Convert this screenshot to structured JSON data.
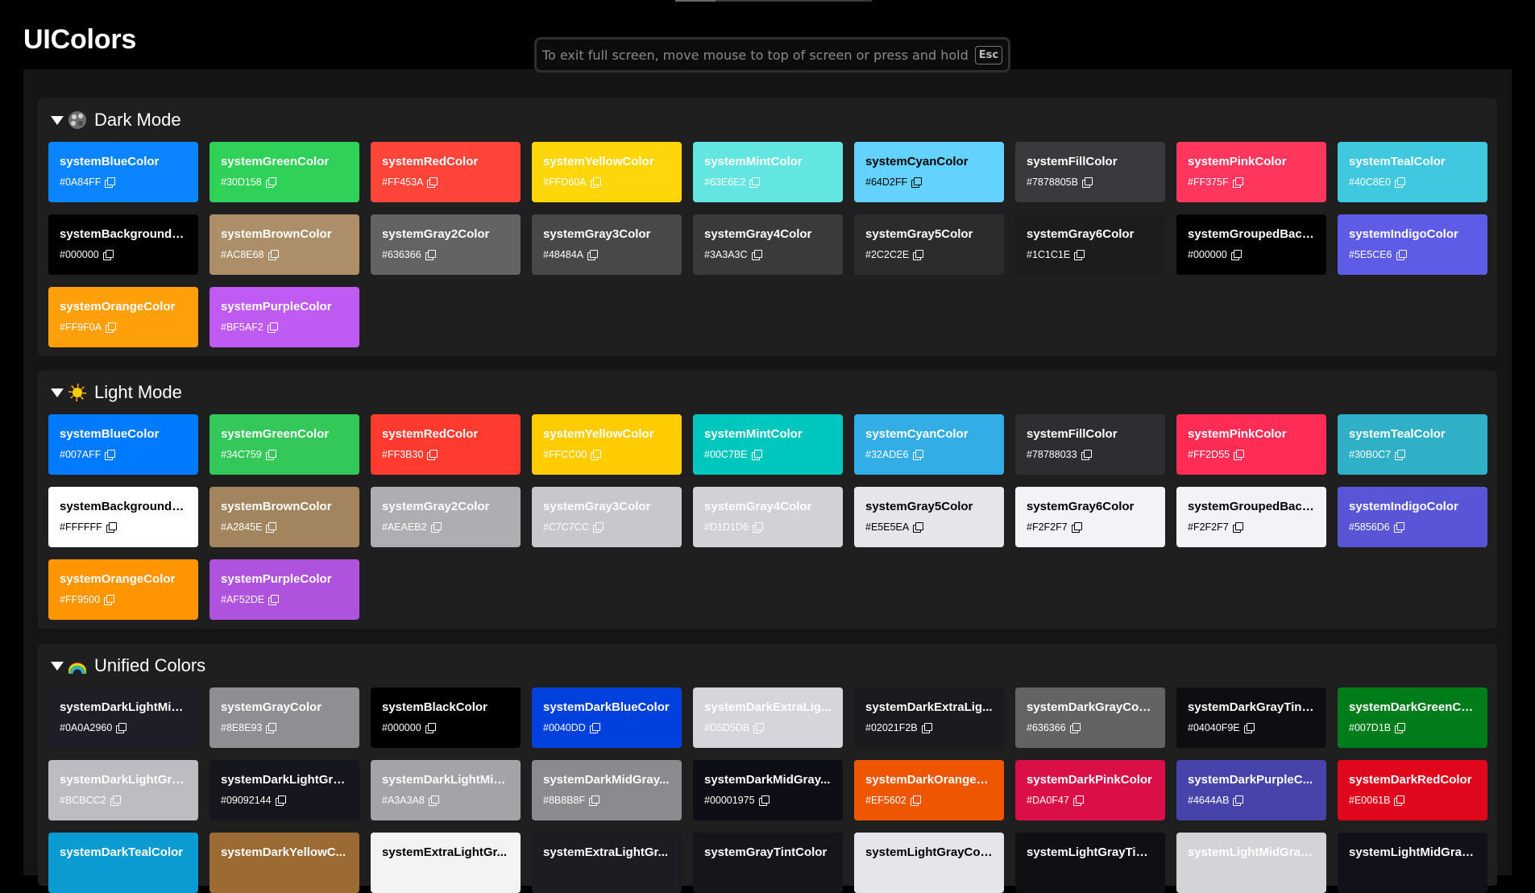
{
  "app": {
    "title": "UIColors"
  },
  "banner": {
    "text": "To exit full screen, move mouse to top of screen or press and hold",
    "key": "Esc"
  },
  "sections": [
    {
      "title": "Dark Mode",
      "emoji": "palette-icon",
      "colors": [
        {
          "name": "systemBlueColor",
          "hex": "#0A84FF",
          "bg": "#0A84FF",
          "fg": "#FFFFFF"
        },
        {
          "name": "systemGreenColor",
          "hex": "#30D158",
          "bg": "#30D158",
          "fg": "#FFFFFF"
        },
        {
          "name": "systemRedColor",
          "hex": "#FF453A",
          "bg": "#FF453A",
          "fg": "#FFFFFF"
        },
        {
          "name": "systemYellowColor",
          "hex": "#FFD60A",
          "bg": "#FFD60A",
          "fg": "#FFFFFF"
        },
        {
          "name": "systemMintColor",
          "hex": "#63E6E2",
          "bg": "#63E6E2",
          "fg": "#FFFFFF"
        },
        {
          "name": "systemCyanColor",
          "hex": "#64D2FF",
          "bg": "#64D2FF",
          "fg": "#000000"
        },
        {
          "name": "systemFillColor",
          "hex": "#7878805B",
          "bg": "#3A3A3E",
          "fg": "#FFFFFF"
        },
        {
          "name": "systemPinkColor",
          "hex": "#FF375F",
          "bg": "#FF375F",
          "fg": "#FFFFFF"
        },
        {
          "name": "systemTealColor",
          "hex": "#40C8E0",
          "bg": "#40C8E0",
          "fg": "#FFFFFF"
        },
        {
          "name": "systemBackgroundC...",
          "hex": "#000000",
          "bg": "#000000",
          "fg": "#FFFFFF"
        },
        {
          "name": "systemBrownColor",
          "hex": "#AC8E68",
          "bg": "#AC8E68",
          "fg": "#FFFFFF"
        },
        {
          "name": "systemGray2Color",
          "hex": "#636366",
          "bg": "#636366",
          "fg": "#FFFFFF"
        },
        {
          "name": "systemGray3Color",
          "hex": "#48484A",
          "bg": "#48484A",
          "fg": "#FFFFFF"
        },
        {
          "name": "systemGray4Color",
          "hex": "#3A3A3C",
          "bg": "#3A3A3C",
          "fg": "#FFFFFF"
        },
        {
          "name": "systemGray5Color",
          "hex": "#2C2C2E",
          "bg": "#2C2C2E",
          "fg": "#FFFFFF"
        },
        {
          "name": "systemGray6Color",
          "hex": "#1C1C1E",
          "bg": "#1C1C1E",
          "fg": "#FFFFFF"
        },
        {
          "name": "systemGroupedBack...",
          "hex": "#000000",
          "bg": "#000000",
          "fg": "#FFFFFF"
        },
        {
          "name": "systemIndigoColor",
          "hex": "#5E5CE6",
          "bg": "#5E5CE6",
          "fg": "#FFFFFF"
        },
        {
          "name": "systemOrangeColor",
          "hex": "#FF9F0A",
          "bg": "#FF9F0A",
          "fg": "#FFFFFF"
        },
        {
          "name": "systemPurpleColor",
          "hex": "#BF5AF2",
          "bg": "#BF5AF2",
          "fg": "#FFFFFF"
        }
      ]
    },
    {
      "title": "Light Mode",
      "emoji": "sun-icon",
      "colors": [
        {
          "name": "systemBlueColor",
          "hex": "#007AFF",
          "bg": "#007AFF",
          "fg": "#FFFFFF"
        },
        {
          "name": "systemGreenColor",
          "hex": "#34C759",
          "bg": "#34C759",
          "fg": "#FFFFFF"
        },
        {
          "name": "systemRedColor",
          "hex": "#FF3B30",
          "bg": "#FF3B30",
          "fg": "#FFFFFF"
        },
        {
          "name": "systemYellowColor",
          "hex": "#FFCC00",
          "bg": "#FFCC00",
          "fg": "#FFFFFF"
        },
        {
          "name": "systemMintColor",
          "hex": "#00C7BE",
          "bg": "#00C7BE",
          "fg": "#FFFFFF"
        },
        {
          "name": "systemCyanColor",
          "hex": "#32ADE6",
          "bg": "#32ADE6",
          "fg": "#FFFFFF"
        },
        {
          "name": "systemFillColor",
          "hex": "#78788033",
          "bg": "#2E2E32",
          "fg": "#FFFFFF"
        },
        {
          "name": "systemPinkColor",
          "hex": "#FF2D55",
          "bg": "#FF2D55",
          "fg": "#FFFFFF"
        },
        {
          "name": "systemTealColor",
          "hex": "#30B0C7",
          "bg": "#30B0C7",
          "fg": "#FFFFFF"
        },
        {
          "name": "systemBackgroundC...",
          "hex": "#FFFFFF",
          "bg": "#FFFFFF",
          "fg": "#000000"
        },
        {
          "name": "systemBrownColor",
          "hex": "#A2845E",
          "bg": "#A2845E",
          "fg": "#FFFFFF"
        },
        {
          "name": "systemGray2Color",
          "hex": "#AEAEB2",
          "bg": "#AEAEB2",
          "fg": "#FFFFFF"
        },
        {
          "name": "systemGray3Color",
          "hex": "#C7C7CC",
          "bg": "#C7C7CC",
          "fg": "#FFFFFF"
        },
        {
          "name": "systemGray4Color",
          "hex": "#D1D1D6",
          "bg": "#D1D1D6",
          "fg": "#FFFFFF"
        },
        {
          "name": "systemGray5Color",
          "hex": "#E5E5EA",
          "bg": "#E5E5EA",
          "fg": "#000000"
        },
        {
          "name": "systemGray6Color",
          "hex": "#F2F2F7",
          "bg": "#F2F2F7",
          "fg": "#000000"
        },
        {
          "name": "systemGroupedBack...",
          "hex": "#F2F2F7",
          "bg": "#F2F2F7",
          "fg": "#000000"
        },
        {
          "name": "systemIndigoColor",
          "hex": "#5856D6",
          "bg": "#5856D6",
          "fg": "#FFFFFF"
        },
        {
          "name": "systemOrangeColor",
          "hex": "#FF9500",
          "bg": "#FF9500",
          "fg": "#FFFFFF"
        },
        {
          "name": "systemPurpleColor",
          "hex": "#AF52DE",
          "bg": "#AF52DE",
          "fg": "#FFFFFF"
        }
      ]
    },
    {
      "title": "Unified Colors",
      "emoji": "rainbow-icon",
      "colors": [
        {
          "name": "systemDarkLightMid...",
          "hex": "#0A0A2960",
          "bg": "#1E1E28",
          "fg": "#FFFFFF"
        },
        {
          "name": "systemGrayColor",
          "hex": "#8E8E93",
          "bg": "#8E8E93",
          "fg": "#FFFFFF"
        },
        {
          "name": "systemBlackColor",
          "hex": "#000000",
          "bg": "#000000",
          "fg": "#FFFFFF"
        },
        {
          "name": "systemDarkBlueColor",
          "hex": "#0040DD",
          "bg": "#0040DD",
          "fg": "#FFFFFF"
        },
        {
          "name": "systemDarkExtraLig...",
          "hex": "#D5D5DB",
          "bg": "#D5D5DB",
          "fg": "#FFFFFF"
        },
        {
          "name": "systemDarkExtraLig...",
          "hex": "#02021F2B",
          "bg": "#1A1A1F",
          "fg": "#FFFFFF"
        },
        {
          "name": "systemDarkGrayColor",
          "hex": "#636366",
          "bg": "#636366",
          "fg": "#FFFFFF"
        },
        {
          "name": "systemDarkGrayTint...",
          "hex": "#04040F9E",
          "bg": "#0D0D12",
          "fg": "#FFFFFF"
        },
        {
          "name": "systemDarkGreenCo...",
          "hex": "#007D1B",
          "bg": "#007D1B",
          "fg": "#FFFFFF"
        },
        {
          "name": "systemDarkLightGra...",
          "hex": "#BCBCC2",
          "bg": "#BCBCC2",
          "fg": "#FFFFFF"
        },
        {
          "name": "systemDarkLightGra...",
          "hex": "#09092144",
          "bg": "#16161E",
          "fg": "#FFFFFF"
        },
        {
          "name": "systemDarkLightMid...",
          "hex": "#A3A3A8",
          "bg": "#A3A3A8",
          "fg": "#FFFFFF"
        },
        {
          "name": "systemDarkMidGray...",
          "hex": "#8B8B8F",
          "bg": "#8B8B8F",
          "fg": "#FFFFFF"
        },
        {
          "name": "systemDarkMidGray...",
          "hex": "#00001975",
          "bg": "#0E0E16",
          "fg": "#FFFFFF"
        },
        {
          "name": "systemDarkOrangeC...",
          "hex": "#EF5602",
          "bg": "#EF5602",
          "fg": "#FFFFFF"
        },
        {
          "name": "systemDarkPinkColor",
          "hex": "#DA0F47",
          "bg": "#DA0F47",
          "fg": "#FFFFFF"
        },
        {
          "name": "systemDarkPurpleC...",
          "hex": "#4644AB",
          "bg": "#4644AB",
          "fg": "#FFFFFF"
        },
        {
          "name": "systemDarkRedColor",
          "hex": "#E0061B",
          "bg": "#E0061B",
          "fg": "#FFFFFF"
        },
        {
          "name": "systemDarkTealColor",
          "hex": "",
          "bg": "#0A9BD3",
          "fg": "#FFFFFF"
        },
        {
          "name": "systemDarkYellowC...",
          "hex": "",
          "bg": "#9C6B34",
          "fg": "#FFFFFF"
        },
        {
          "name": "systemExtraLightGr...",
          "hex": "",
          "bg": "#F3F3F6",
          "fg": "#000000"
        },
        {
          "name": "systemExtraLightGr...",
          "hex": "",
          "bg": "#1C1C22",
          "fg": "#FFFFFF"
        },
        {
          "name": "systemGrayTintColor",
          "hex": "",
          "bg": "#15151C",
          "fg": "#FFFFFF"
        },
        {
          "name": "systemLightGrayColor",
          "hex": "",
          "bg": "#E5E5EA",
          "fg": "#000000"
        },
        {
          "name": "systemLightGrayTint...",
          "hex": "",
          "bg": "#0F0F14",
          "fg": "#FFFFFF"
        },
        {
          "name": "systemLightMidGray...",
          "hex": "",
          "bg": "#D4D4D8",
          "fg": "#FFFFFF"
        },
        {
          "name": "systemLightMidGray...",
          "hex": "",
          "bg": "#11111A",
          "fg": "#FFFFFF"
        }
      ]
    }
  ]
}
